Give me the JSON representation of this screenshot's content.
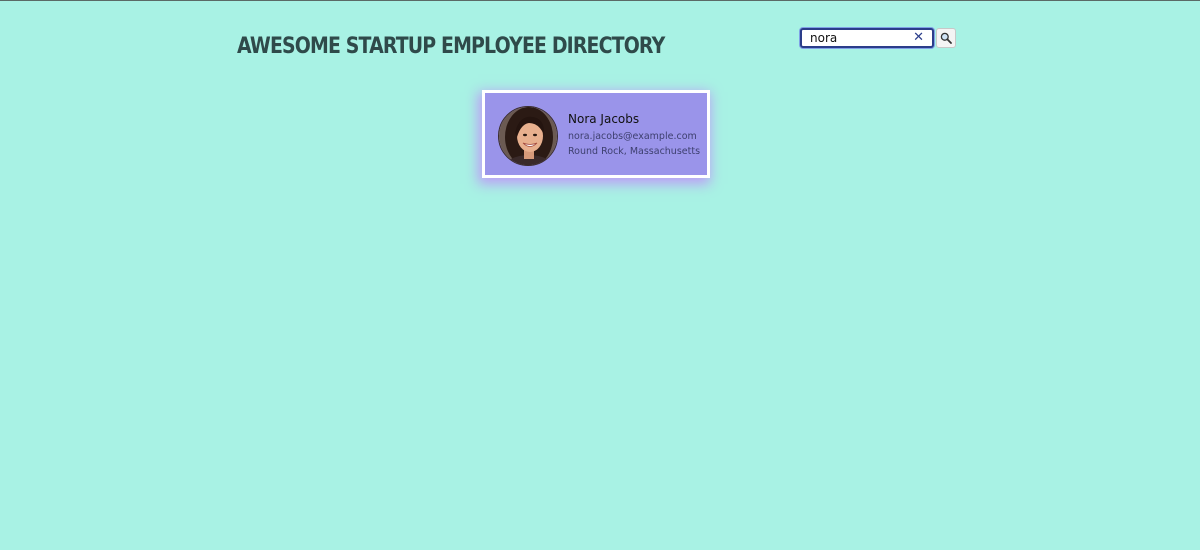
{
  "header": {
    "title": "Awesome Startup Employee Directory"
  },
  "search": {
    "value": "nora",
    "clear_icon": "close-icon",
    "button_icon": "search-icon"
  },
  "results": [
    {
      "name": "Nora Jacobs",
      "email": "nora.jacobs@example.com",
      "location": "Round Rock, Massachusetts",
      "avatar_icon": "avatar-photo"
    }
  ],
  "colors": {
    "background": "#a8f2e4",
    "card_background": "#9a94ea",
    "card_border": "#ffffff",
    "card_glow": "#c86eff",
    "title_text": "#2f4a4a",
    "search_focus_border": "#2b3d8a"
  }
}
